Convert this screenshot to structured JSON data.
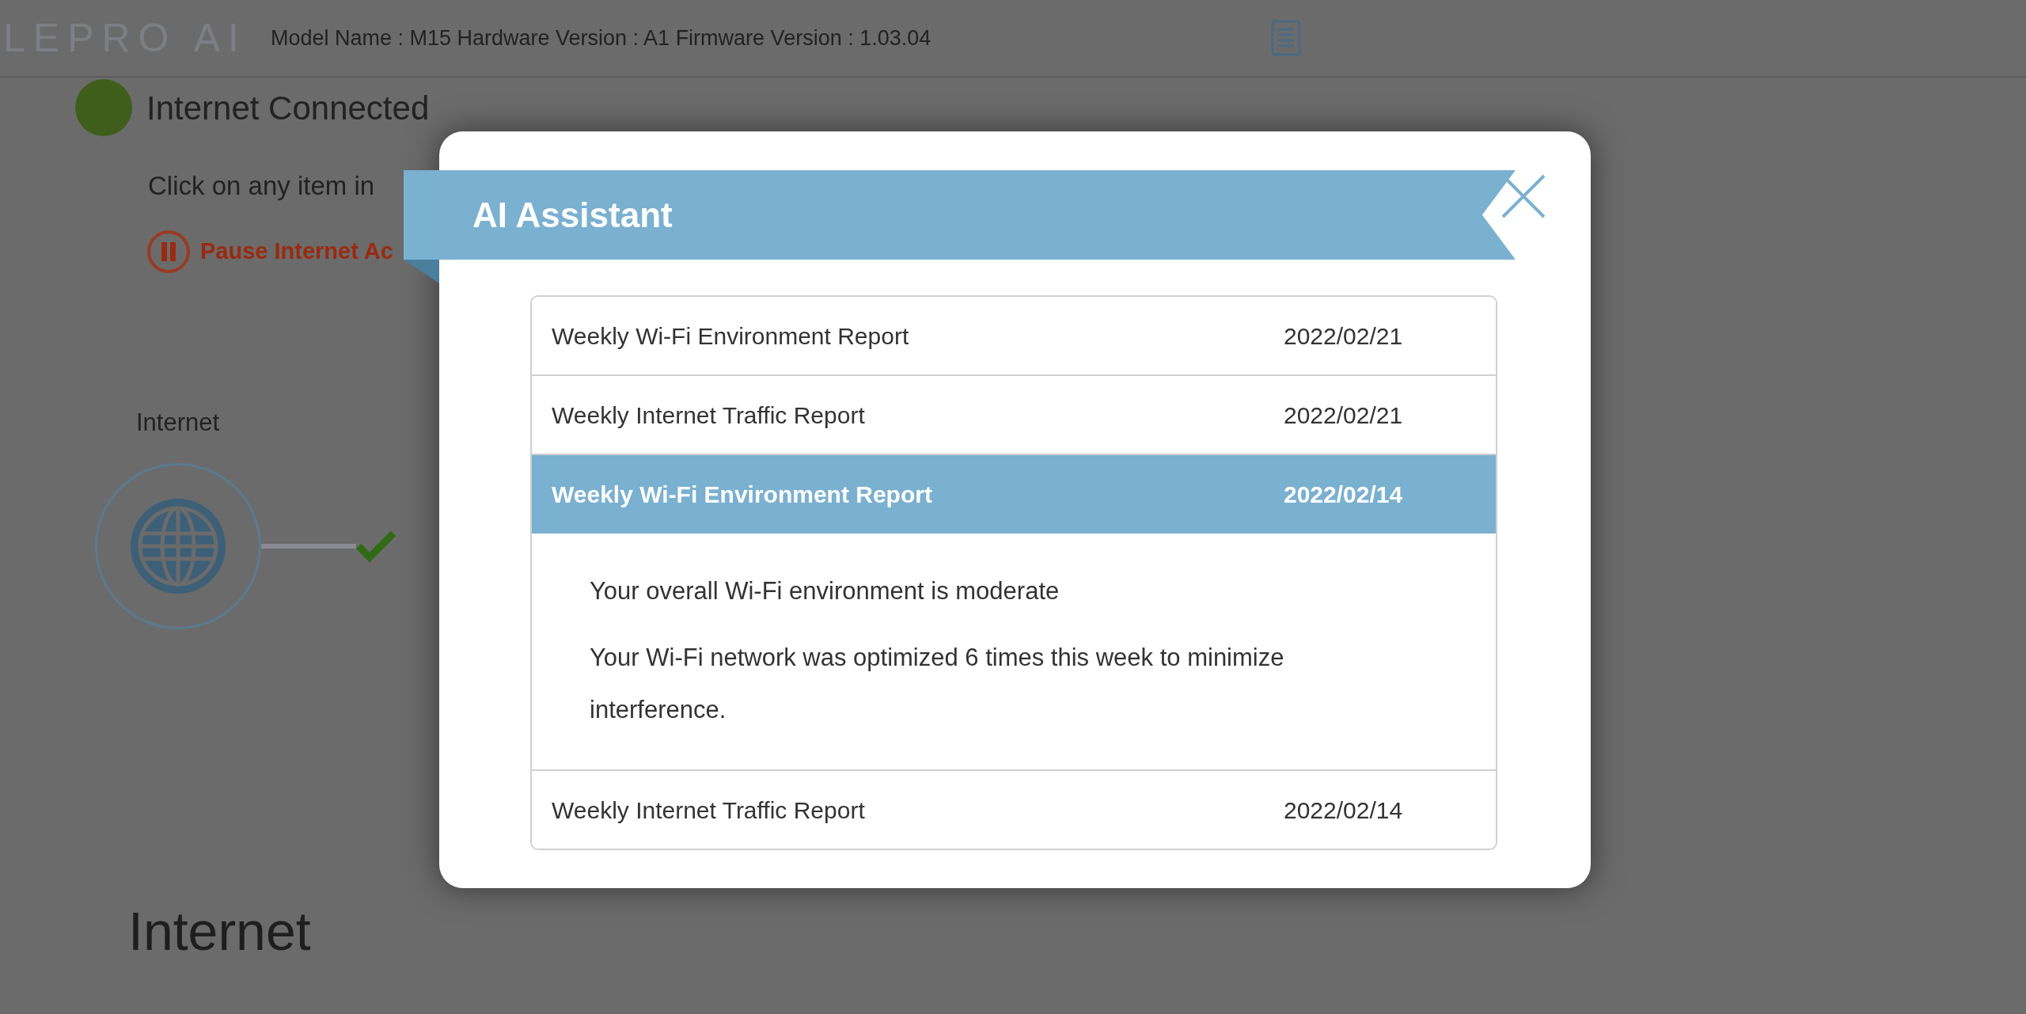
{
  "header": {
    "logo": "LEPRO AI",
    "device_info": "Model Name : M15 Hardware Version : A1 Firmware Version : 1.03.04"
  },
  "status": {
    "label": "Internet Connected",
    "color": "#3f5e1c"
  },
  "hint": "Click on any item in",
  "pause_link": "Pause Internet Ac",
  "diagram": {
    "label": "Internet"
  },
  "section_heading": "Internet",
  "dialog": {
    "title": "AI Assistant",
    "reports": [
      {
        "title": "Weekly Wi-Fi Environment Report",
        "date": "2022/02/21",
        "selected": false
      },
      {
        "title": "Weekly Internet Traffic Report",
        "date": "2022/02/21",
        "selected": false
      },
      {
        "title": "Weekly Wi-Fi Environment Report",
        "date": "2022/02/14",
        "selected": true,
        "details": [
          "Your overall Wi-Fi environment is moderate",
          "Your Wi-Fi network was optimized 6 times this week to minimize interference."
        ]
      },
      {
        "title": "Weekly Internet Traffic Report",
        "date": "2022/02/14",
        "selected": false
      }
    ]
  }
}
